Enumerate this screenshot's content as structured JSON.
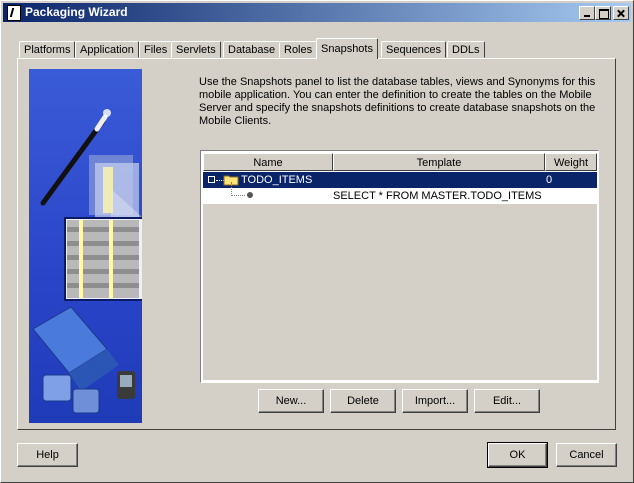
{
  "window": {
    "title": "Packaging Wizard"
  },
  "tabs": [
    {
      "label": "Platforms"
    },
    {
      "label": "Application"
    },
    {
      "label": "Files"
    },
    {
      "label": "Servlets"
    },
    {
      "label": "Database"
    },
    {
      "label": "Roles"
    },
    {
      "label": "Snapshots"
    },
    {
      "label": "Sequences"
    },
    {
      "label": "DDLs"
    }
  ],
  "active_tab": "Snapshots",
  "description": "Use the Snapshots panel to list the database tables, views and Synonyms for this mobile application. You can enter the definition to create the tables on the Mobile Server and specify the snapshots definitions to create database snapshots on the Mobile Clients.",
  "table": {
    "columns": [
      "Name",
      "Template",
      "Weight"
    ],
    "rows": [
      {
        "name": "TODO_ITEMS",
        "template": "",
        "weight": "0",
        "selected": true
      },
      {
        "name": "",
        "template": "SELECT * FROM MASTER.TODO_ITEMS",
        "weight": ""
      }
    ]
  },
  "actions": {
    "new": "New...",
    "delete": "Delete",
    "import": "Import...",
    "edit": "Edit..."
  },
  "footer": {
    "help": "Help",
    "ok": "OK",
    "cancel": "Cancel"
  },
  "colors": {
    "title_start": "#0a246a",
    "title_end": "#a6caf0",
    "selection": "#0a246a",
    "face": "#d4d0c8"
  }
}
